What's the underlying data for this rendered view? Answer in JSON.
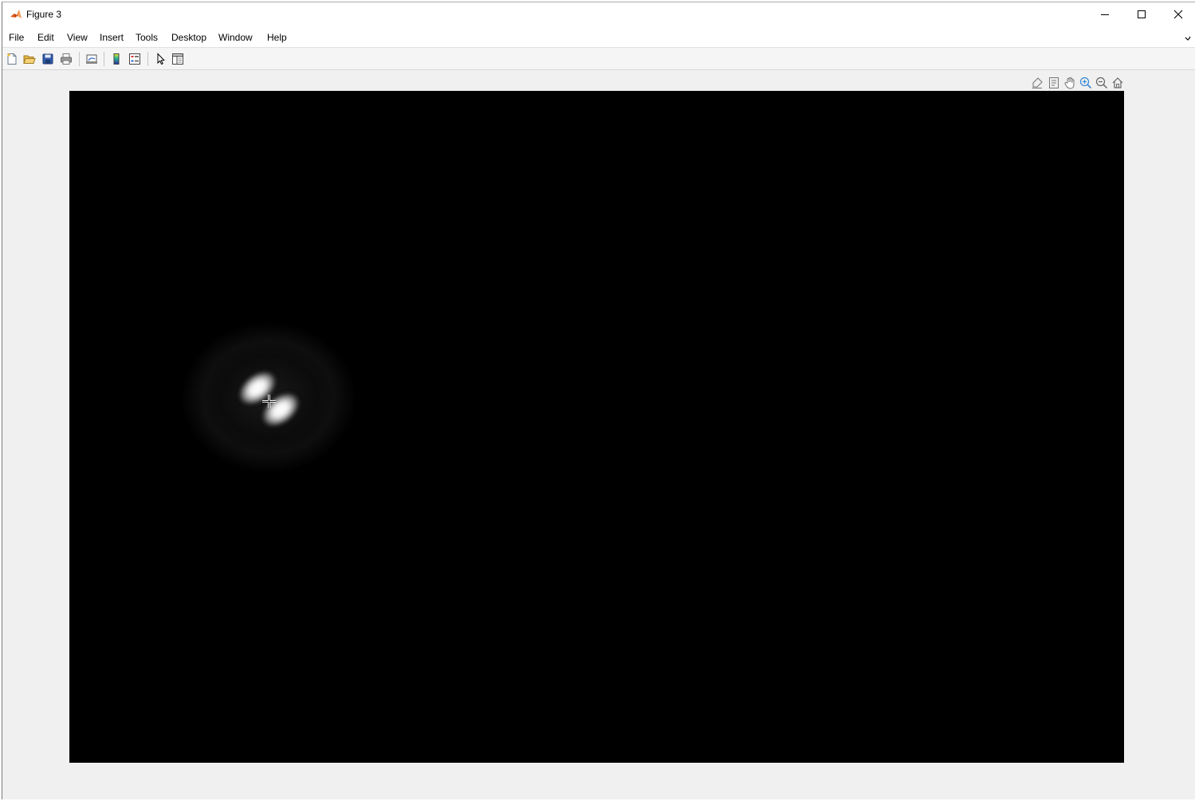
{
  "window": {
    "title": "Figure 3",
    "app_icon": "matlab-icon",
    "controls": [
      "minimize-icon",
      "maximize-icon",
      "close-icon"
    ]
  },
  "menubar": {
    "items": [
      "File",
      "Edit",
      "View",
      "Insert",
      "Tools",
      "Desktop",
      "Window",
      "Help"
    ]
  },
  "toolbar": {
    "buttons": [
      "new-figure-icon",
      "open-file-icon",
      "save-icon",
      "print-icon",
      "link-plot-icon",
      "insert-colorbar-icon",
      "insert-legend-icon",
      "edit-plot-icon",
      "property-inspector-icon"
    ]
  },
  "axes_toolbar": {
    "buttons": [
      "brush-icon",
      "data-tips-icon",
      "pan-icon",
      "zoom-in-icon",
      "zoom-out-icon",
      "restore-view-icon"
    ]
  },
  "image": {
    "description_type": "grayscale-intensity",
    "background_color": "#000000",
    "spot_color": "#ffffff"
  },
  "cursor": "crosshair-icon"
}
